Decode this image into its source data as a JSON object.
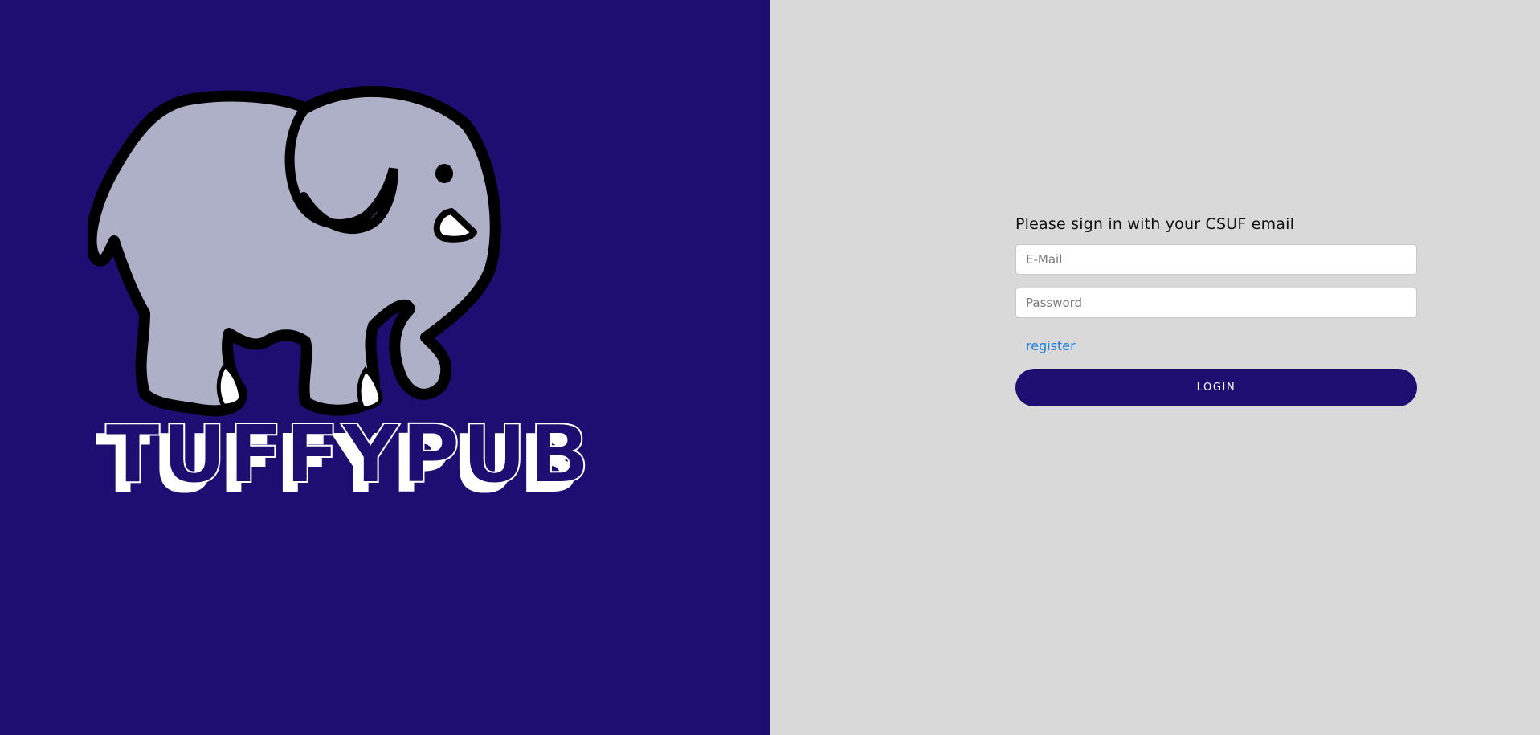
{
  "brand": {
    "logo_icon": "elephant-icon",
    "wordmark": "TUFFYPUB"
  },
  "login_form": {
    "title": "Please sign in with your CSUF email",
    "email_placeholder": "E-Mail",
    "password_placeholder": "Password",
    "register_label": "register",
    "login_label": "LOGIN"
  },
  "colors": {
    "primary": "#1f0e72",
    "panel_background": "#d9d9d9",
    "link": "#1e7fe0",
    "elephant_body": "#aeb0c8"
  }
}
